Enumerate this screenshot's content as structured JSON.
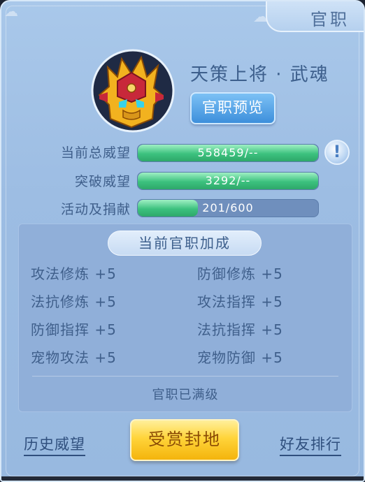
{
  "title": "官职",
  "rank": {
    "name": "天策上将 · 武魂",
    "preview_button": "官职预览",
    "emblem_icon": "golden-helmet-icon"
  },
  "stats": [
    {
      "label": "当前总威望",
      "text": "558459/--",
      "fill": 1.0
    },
    {
      "label": "突破威望",
      "text": "3292/--",
      "fill": 1.0
    },
    {
      "label": "活动及捐献",
      "text": "201/600",
      "fill": 0.335
    }
  ],
  "info_icon": "!",
  "bonus": {
    "header": "当前官职加成",
    "items": [
      {
        "name": "攻法修炼",
        "value": "+5"
      },
      {
        "name": "防御修炼",
        "value": "+5"
      },
      {
        "name": "法抗修炼",
        "value": "+5"
      },
      {
        "name": "攻法指挥",
        "value": "+5"
      },
      {
        "name": "防御指挥",
        "value": "+5"
      },
      {
        "name": "法抗指挥",
        "value": "+5"
      },
      {
        "name": "宠物攻法",
        "value": "+5"
      },
      {
        "name": "宠物防御",
        "value": "+5"
      }
    ],
    "status": "官职已满级"
  },
  "footer": {
    "history_link": "历史威望",
    "reward_button": "受赏封地",
    "friends_link": "好友排行"
  },
  "colors": {
    "panel_bg": "#9dbde3",
    "bar_fill": "#3cc17e",
    "bar_track": "#6f8fbd",
    "reward_button": "#ffd43a",
    "preview_button": "#3d8fdb"
  }
}
